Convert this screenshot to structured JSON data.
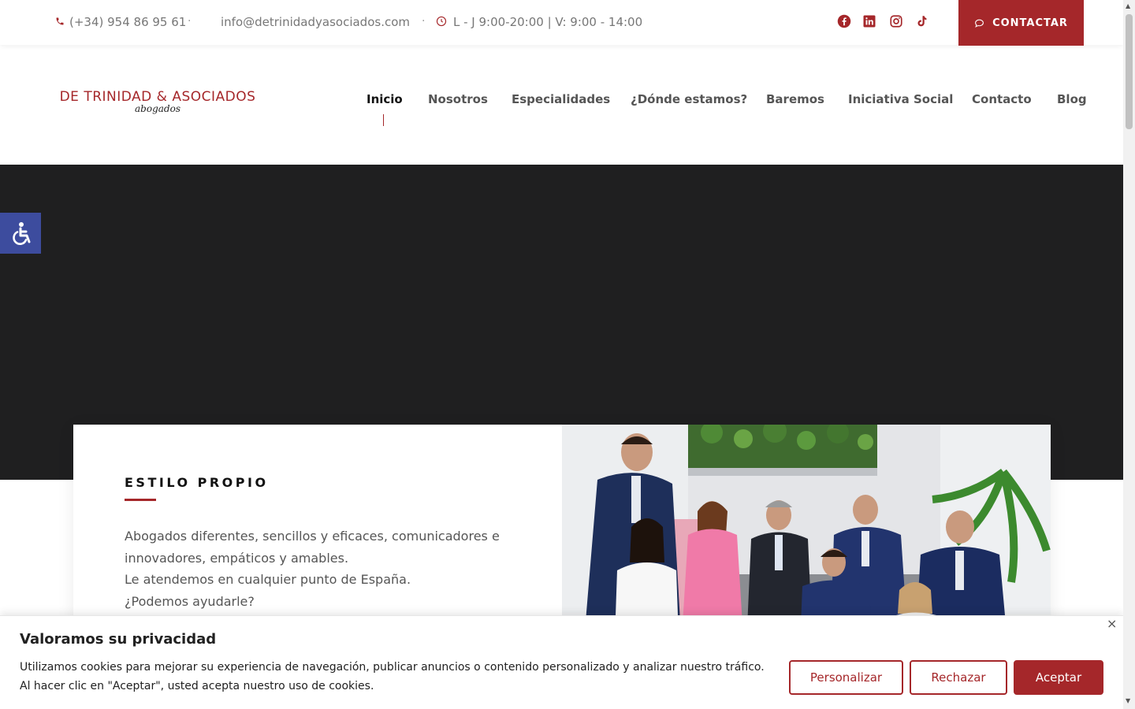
{
  "topbar": {
    "phone": "(+34) 954 86 95 61",
    "separator": "·",
    "email": "info@detrinidadyasociados.com",
    "hours": "L - J 9:00-20:00 | V: 9:00 - 14:00",
    "social_icons": [
      "facebook-icon",
      "linkedin-icon",
      "instagram-icon",
      "tiktok-icon"
    ],
    "contact_button": "CONTACTAR"
  },
  "logo": {
    "line1": "DE TRINIDAD & ASOCIADOS",
    "line2": "abogados"
  },
  "nav": {
    "items": [
      "Inicio",
      "Nosotros",
      "Especialidades",
      "¿Dónde estamos?",
      "Baremos",
      "Iniciativa Social",
      "Contacto",
      "Blog"
    ],
    "active": "Inicio"
  },
  "card": {
    "title": "ESTILO PROPIO",
    "line1": "Abogados diferentes, sencillos y eficaces, comunicadores e innovadores, empáticos y amables.",
    "line2": "Le atendemos en cualquier punto de España.",
    "line3": "¿Podemos ayudarle?"
  },
  "cookie": {
    "title": "Valoramos su privacidad",
    "text": "Utilizamos cookies para mejorar su experiencia de navegación, publicar anuncios o contenido personalizado y analizar nuestro tráfico. Al hacer clic en \"Aceptar\", usted acepta nuestro uso de cookies.",
    "customize": "Personalizar",
    "reject": "Rechazar",
    "accept": "Aceptar",
    "close": "×"
  },
  "colors": {
    "brand": "#a5272a",
    "hero_bg": "#1f1f20",
    "a11y_bg": "#3d4c9e"
  }
}
